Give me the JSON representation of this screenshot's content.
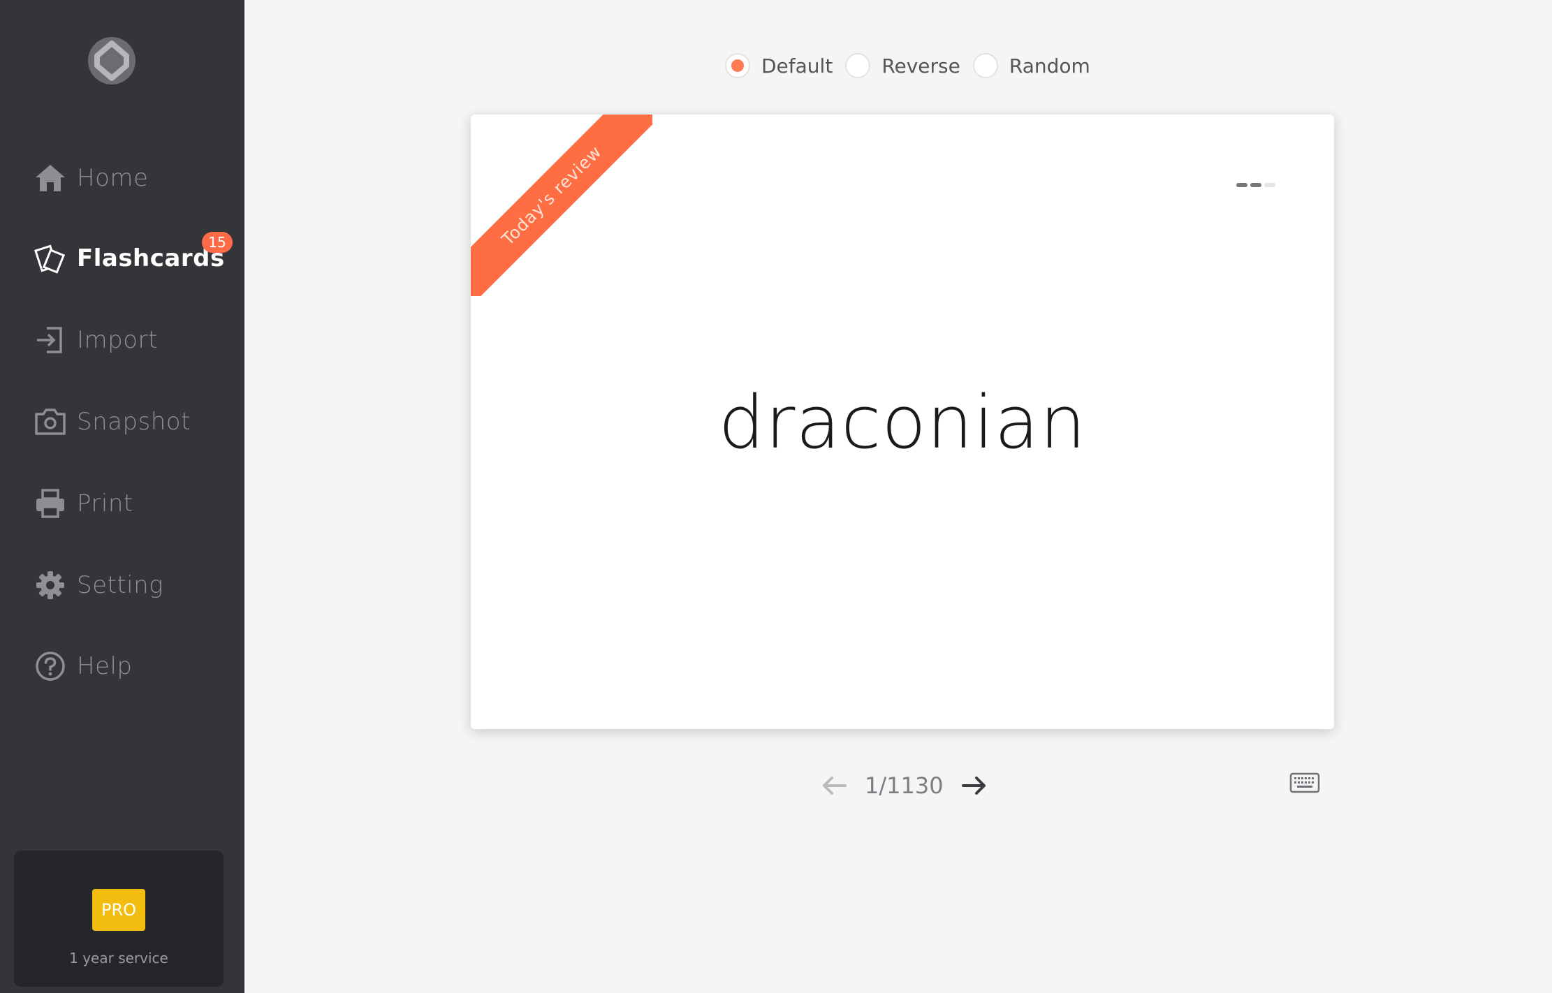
{
  "sidebar": {
    "items": [
      {
        "label": "Home",
        "icon": "home-icon"
      },
      {
        "label": "Flashcards",
        "icon": "flashcards-icon",
        "active": true,
        "badge": "15"
      },
      {
        "label": "Import",
        "icon": "import-icon"
      },
      {
        "label": "Snapshot",
        "icon": "camera-icon"
      },
      {
        "label": "Print",
        "icon": "printer-icon"
      },
      {
        "label": "Setting",
        "icon": "gear-icon"
      },
      {
        "label": "Help",
        "icon": "help-icon"
      }
    ],
    "pro": {
      "badge": "PRO",
      "text": "1 year service"
    }
  },
  "modes": {
    "options": [
      "Default",
      "Reverse",
      "Random"
    ],
    "selected": "Default"
  },
  "card": {
    "ribbon": "Today's review",
    "word": "draconian"
  },
  "pager": {
    "count": "1/1130"
  },
  "colors": {
    "sidebar_bg": "#343539",
    "accent": "#ff6e42",
    "pro": "#f2bd0f",
    "page_bg": "#f5f5f5"
  }
}
